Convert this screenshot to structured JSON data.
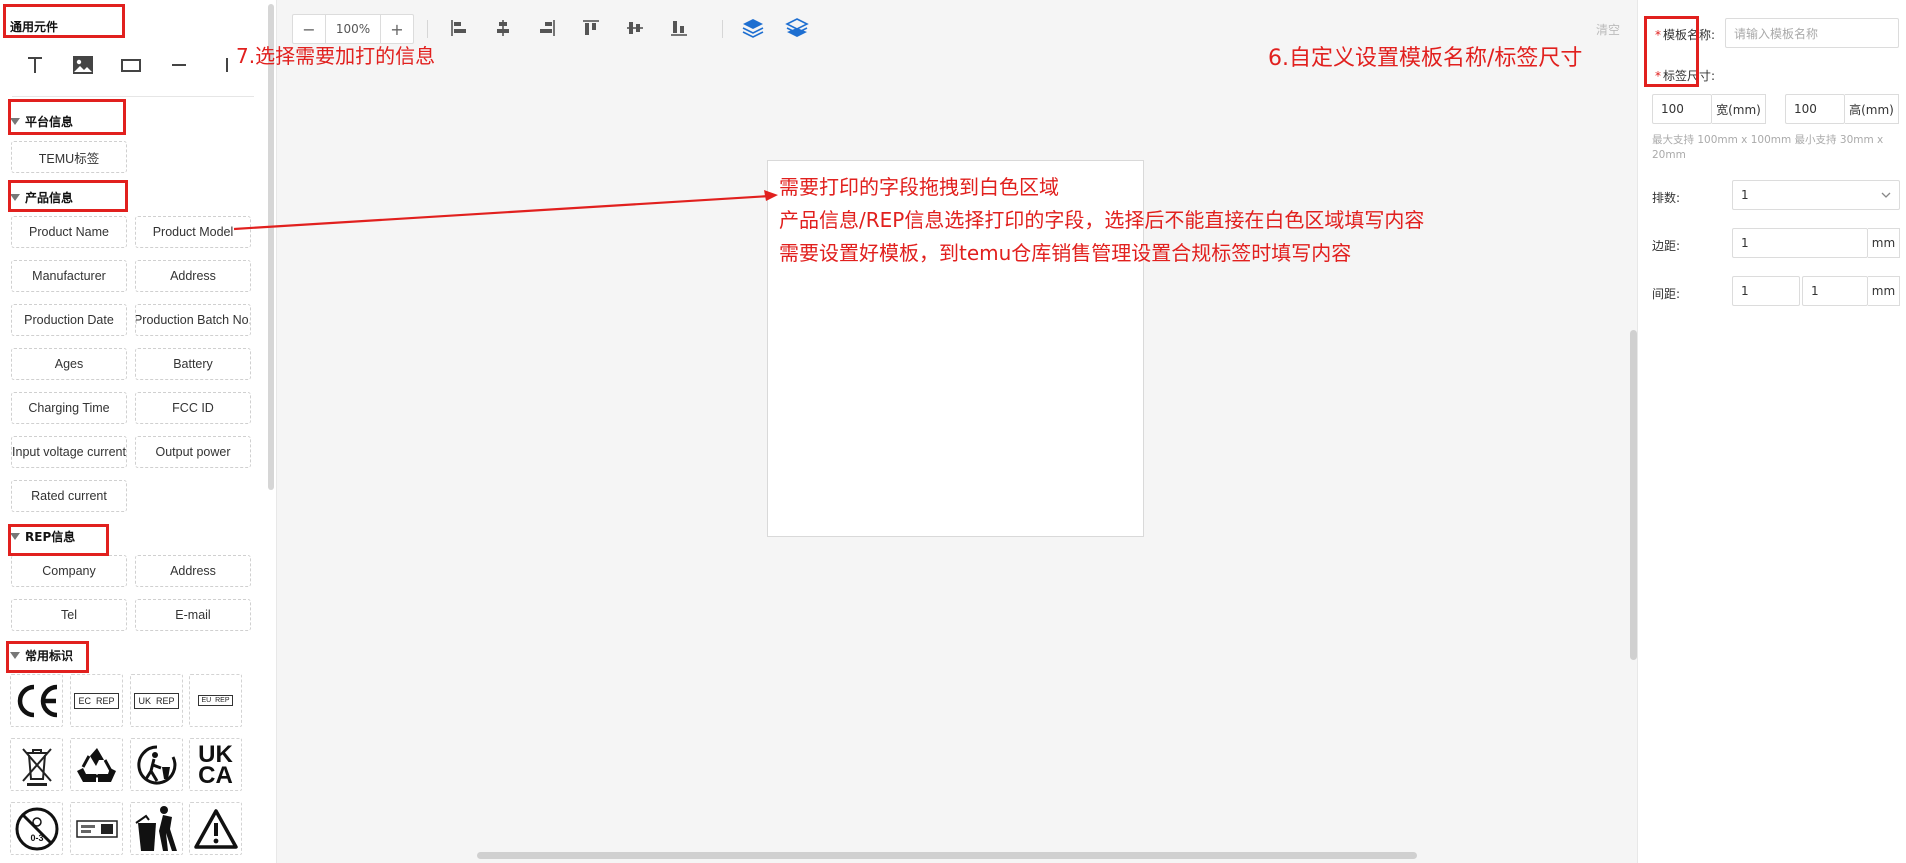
{
  "left_panel": {
    "general_title": "通用元件",
    "platform_title": "平台信息",
    "platform_items": [
      "TEMU标签"
    ],
    "product_title": "产品信息",
    "product_items": [
      "Product Name",
      "Product Model",
      "Manufacturer",
      "Address",
      "Production Date",
      "Production Batch No.",
      "Ages",
      "Battery",
      "Charging Time",
      "FCC ID",
      "Input voltage current",
      "Output power",
      "Rated current"
    ],
    "rep_title": "REP信息",
    "rep_items": [
      "Company",
      "Address",
      "Tel",
      "E-mail"
    ],
    "symbols_title": "常用标识",
    "symbol_texts": {
      "ec_rep": "EC  REP",
      "uk_rep": "UK  REP",
      "eu_rep": "EU  REP",
      "ukca_top": "UK",
      "ukca_bottom": "CA",
      "age": "0-3"
    }
  },
  "toolbar": {
    "zoom_out": "−",
    "zoom_value": "100%",
    "zoom_in": "+",
    "clear": "清空"
  },
  "right_panel": {
    "template_name_label": "模板名称:",
    "template_name_placeholder": "请输入模板名称",
    "label_size_label": "标签尺寸:",
    "width_value": "100",
    "width_unit": "宽(mm)",
    "height_value": "100",
    "height_unit": "高(mm)",
    "size_hint": "最大支持 100mm x 100mm 最小支持 30mm x 20mm",
    "rows_label": "排数:",
    "rows_value": "1",
    "margin_label": "边距:",
    "margin_value": "1",
    "margin_unit": "mm",
    "spacing_label": "间距:",
    "spacing_value_1": "1",
    "spacing_value_2": "1",
    "spacing_unit": "mm"
  },
  "annotations": {
    "step7": "7.选择需要加打的信息",
    "step6": "6.自定义设置模板名称/标签尺寸",
    "note_line1": "需要打印的字段拖拽到白色区域",
    "note_line2": "产品信息/REP信息选择打印的字段，选择后不能直接在白色区域填写内容",
    "note_line3": "需要设置好模板，到temu仓库销售管理设置合规标签时填写内容"
  },
  "colors": {
    "annotation_red": "#e1201e",
    "layer_blue": "#1e6fd1"
  }
}
